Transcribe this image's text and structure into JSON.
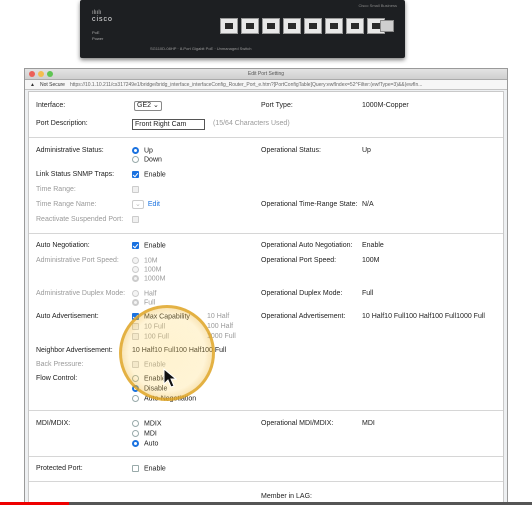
{
  "device": {
    "brand": "cisco",
    "model_label": "SG110D-08HP · 8-Port Gigabit PoE · Unmanaged Switch",
    "top_right_label": "Cisco Small Business",
    "led_labels": [
      "PoE",
      "Power"
    ]
  },
  "window": {
    "title": "Edit Port Setting",
    "security": "Not Secure",
    "url": "https://10.1.10.211/cs317249e1/bridge/bridg_interface_interfaceConfig_Router_Port_e.htm?[PortConfigTable]Query:ewfIndex=52^Filter:(ewfType=3)&&(ewfIn..."
  },
  "form": {
    "interface_label": "Interface:",
    "interface_value": "GE2",
    "port_type_label": "Port Type:",
    "port_type_value": "1000M-Copper",
    "port_description_label": "Port Description:",
    "port_description_value": "Front Right Cam",
    "port_description_hint": "(15/64 Characters Used)",
    "admin_status_label": "Administrative Status:",
    "admin_status_options": [
      "Up",
      "Down"
    ],
    "op_status_label": "Operational Status:",
    "op_status_value": "Up",
    "snmp_traps_label": "Link Status SNMP Traps:",
    "snmp_traps_option": "Enable",
    "time_range_label": "Time Range:",
    "time_range_name_label": "Time Range Name:",
    "time_range_edit": "Edit",
    "op_time_range_label": "Operational Time-Range State:",
    "op_time_range_value": "N/A",
    "reactivate_label": "Reactivate Suspended Port:",
    "auto_neg_label": "Auto Negotiation:",
    "auto_neg_option": "Enable",
    "op_auto_neg_label": "Operational Auto Negotiation:",
    "op_auto_neg_value": "Enable",
    "admin_speed_label": "Administrative Port Speed:",
    "admin_speed_options": [
      "10M",
      "100M",
      "1000M"
    ],
    "op_speed_label": "Operational Port Speed:",
    "op_speed_value": "100M",
    "admin_duplex_label": "Administrative Duplex Mode:",
    "admin_duplex_options": [
      "Half",
      "Full"
    ],
    "op_duplex_label": "Operational Duplex Mode:",
    "op_duplex_value": "Full",
    "auto_adv_label": "Auto Advertisement:",
    "auto_adv_options": [
      "Max Capability",
      "10 Half",
      "10 Full",
      "100 Half",
      "100 Full",
      "1000 Full"
    ],
    "op_auto_adv_label": "Operational Advertisement:",
    "op_auto_adv_value": "10 Half10 Full100 Half100 Full1000 Full",
    "neighbor_adv_label": "Neighbor Advertisement:",
    "neighbor_adv_value": "10 Half10 Full100 Half100 Full",
    "back_pressure_label": "Back Pressure:",
    "back_pressure_option": "Enable",
    "flow_control_label": "Flow Control:",
    "flow_control_options": [
      "Enable",
      "Disable",
      "Auto-Negotiation"
    ],
    "mdix_label": "MDI/MDIX:",
    "mdix_options": [
      "MDIX",
      "MDI",
      "Auto"
    ],
    "op_mdix_label": "Operational MDI/MDIX:",
    "op_mdix_value": "MDI",
    "protected_label": "Protected Port:",
    "protected_option": "Enable",
    "lag_label": "Member in LAG:"
  },
  "video_progress": 0.13,
  "colors": {
    "accent": "#1a72e0",
    "progress": "#e00000"
  }
}
